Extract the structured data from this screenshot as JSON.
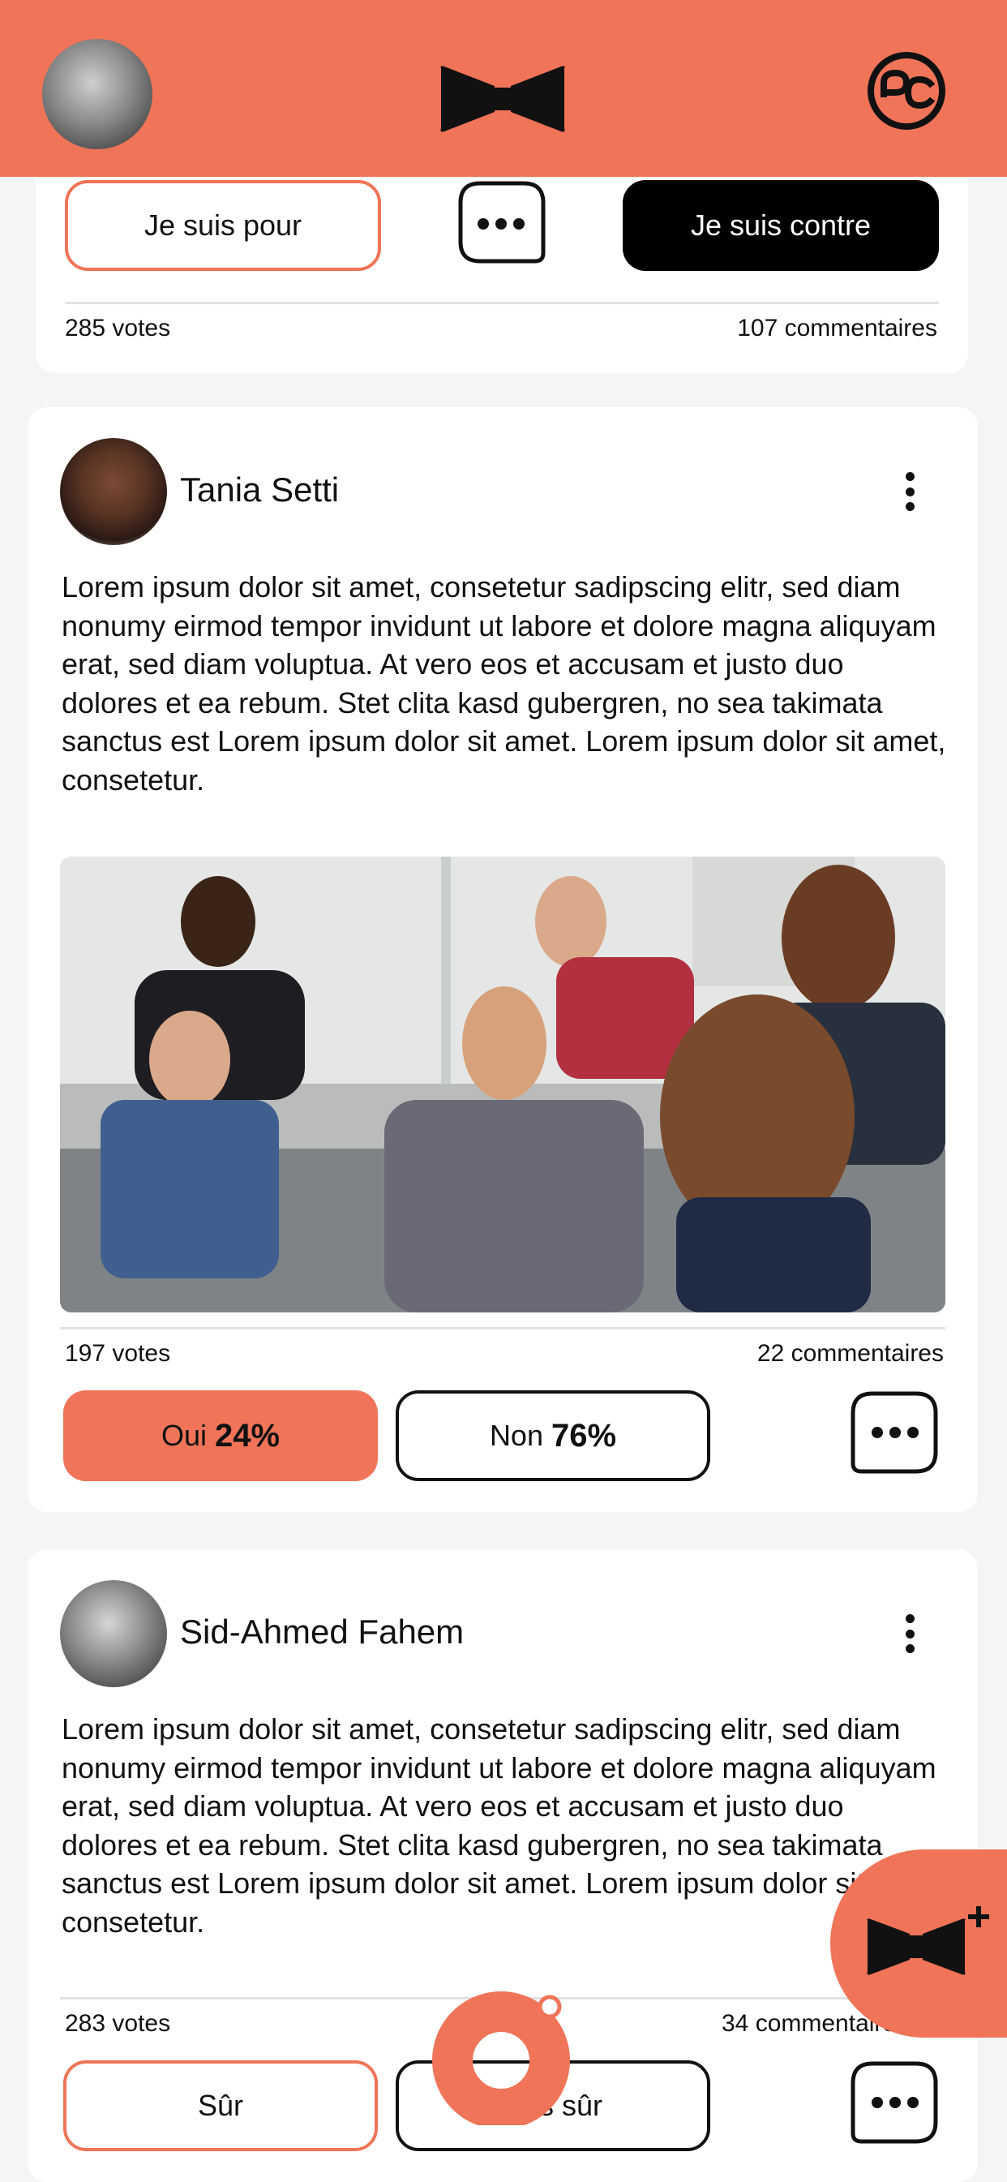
{
  "header": {
    "avatar_label": "profile-avatar",
    "logo_icon": "bowtie-logo",
    "menu_icon": "pc-logo-icon"
  },
  "post1": {
    "for_label": "Je suis pour",
    "against_label": "Je suis contre",
    "votes": "285 votes",
    "comments": "107 commentaires"
  },
  "post2": {
    "author": "Tania Setti",
    "text": "Lorem ipsum dolor sit amet, consetetur sadipscing elitr, sed diam nonumy eirmod tempor invidunt ut labore et dolore magna aliquyam erat, sed diam voluptua. At vero eos et accusam et justo duo dolores et ea rebum. Stet clita kasd gubergren, no sea takimata sanctus est Lorem ipsum dolor sit amet. Lorem ipsum dolor sit amet, consetetur.",
    "votes": "197 votes",
    "comments": "22 commentaires",
    "yes_label": "Oui",
    "yes_pct": "24%",
    "no_label": "Non",
    "no_pct": "76%"
  },
  "post3": {
    "author": "Sid-Ahmed Fahem",
    "text": "Lorem ipsum dolor sit amet, consetetur sadipscing elitr, sed diam nonumy eirmod tempor invidunt ut labore et dolore magna aliquyam erat, sed diam voluptua. At vero eos et accusam et justo duo dolores et ea rebum. Stet clita kasd gubergren, no sea takimata sanctus est Lorem ipsum dolor sit amet. Lorem ipsum dolor sit amet, consetetur.",
    "votes": "283 votes",
    "comments": "34 commentaires",
    "sure_label": "Sûr",
    "not_sure_label": "Pas sûr"
  },
  "colors": {
    "accent": "#f07458",
    "black": "#000000",
    "background": "#f5f5f5"
  }
}
